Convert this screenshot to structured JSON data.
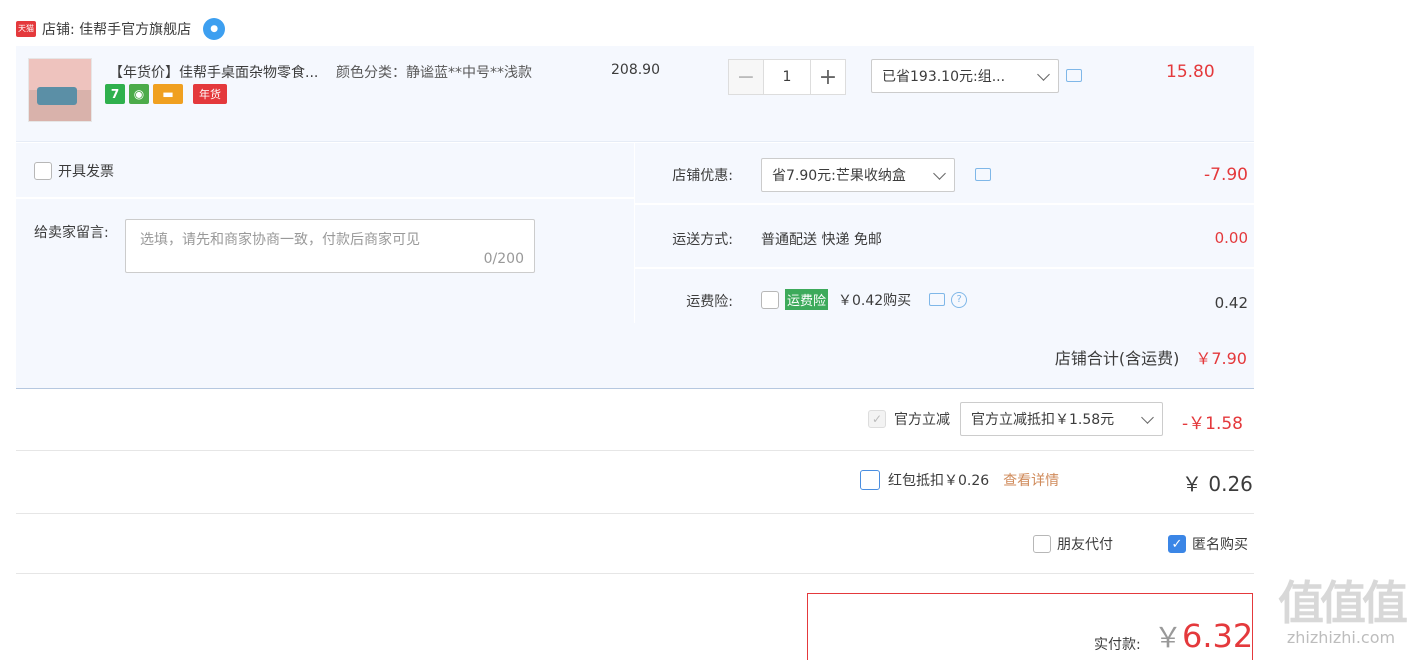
{
  "store": {
    "tmall_icon_text": "天猫",
    "label": "店铺: 佳帮手官方旗舰店"
  },
  "item": {
    "title": "【年货价】佳帮手桌面杂物零食...",
    "sku": "颜色分类：静谧蓝**中号**浅款",
    "badges": [
      "7",
      "年货"
    ],
    "unit_price": "208.90",
    "quantity": "1",
    "minus": "−",
    "plus": "+",
    "promo_selected": "已省193.10元:组...",
    "subtotal": "15.80"
  },
  "order_extras": {
    "invoice_label": "开具发票",
    "memo_label": "给卖家留言:",
    "memo_placeholder": "选填，请先和商家协商一致，付款后商家可见",
    "memo_count": "0/200"
  },
  "discounts": {
    "shop_label": "店铺优惠:",
    "shop_selected": "省7.90元:芒果收纳盒",
    "shop_value": "-7.90",
    "shipping_label": "运送方式:",
    "shipping_text": "普通配送 快递 免邮",
    "shipping_value": "0.00",
    "insurance_label": "运费险:",
    "insurance_badge": "运费险",
    "insurance_text": "￥0.42购买",
    "insurance_value": "0.42",
    "store_total_label": "店铺合计(含运费)",
    "store_total_value": "￥7.90"
  },
  "official": {
    "label": "官方立减",
    "selected": "官方立减抵扣￥1.58元",
    "value": "-￥1.58"
  },
  "redpack": {
    "label": "红包抵扣￥0.26",
    "link": "查看详情",
    "value": "￥ 0.26"
  },
  "options": {
    "friend_pay": "朋友代付",
    "anonymous": "匿名购买"
  },
  "payment": {
    "label": "实付款:",
    "currency": "￥",
    "amount": "6.32"
  },
  "watermark": {
    "chars": "值值值",
    "site": "zhizhizhi.com"
  }
}
